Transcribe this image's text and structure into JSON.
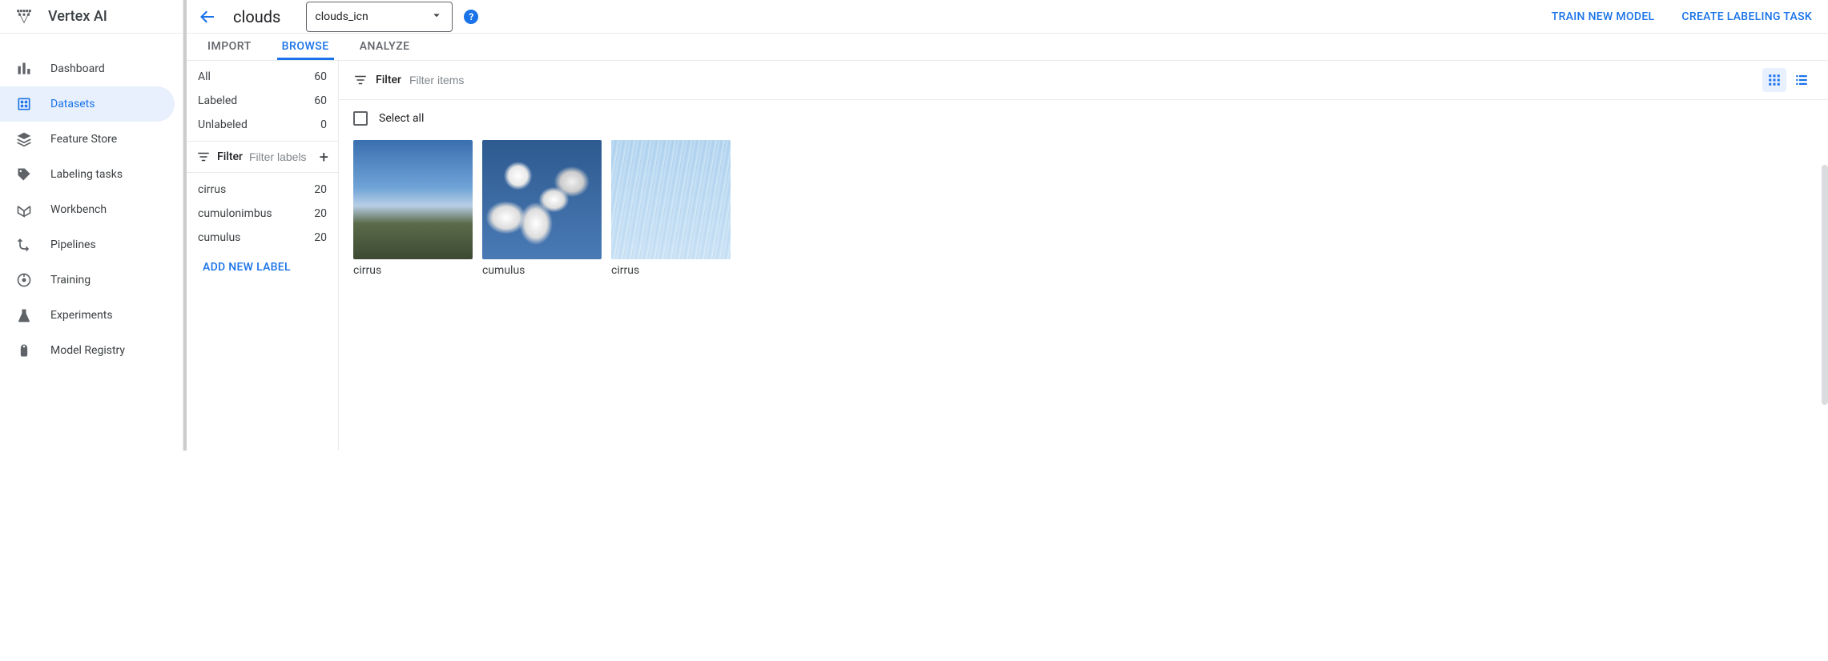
{
  "brand": {
    "title": "Vertex AI"
  },
  "nav": [
    {
      "label": "Dashboard",
      "icon": "dashboard-icon",
      "active": false
    },
    {
      "label": "Datasets",
      "icon": "datasets-icon",
      "active": true
    },
    {
      "label": "Feature Store",
      "icon": "feature-store-icon",
      "active": false
    },
    {
      "label": "Labeling tasks",
      "icon": "tag-icon",
      "active": false
    },
    {
      "label": "Workbench",
      "icon": "workbench-icon",
      "active": false
    },
    {
      "label": "Pipelines",
      "icon": "pipelines-icon",
      "active": false
    },
    {
      "label": "Training",
      "icon": "training-icon",
      "active": false
    },
    {
      "label": "Experiments",
      "icon": "experiments-icon",
      "active": false
    },
    {
      "label": "Model Registry",
      "icon": "model-registry-icon",
      "active": false
    }
  ],
  "header": {
    "dataset_name": "clouds",
    "selected_model": "clouds_icn",
    "actions": {
      "train": "TRAIN NEW MODEL",
      "label_task": "CREATE LABELING TASK"
    }
  },
  "tabs": [
    {
      "label": "IMPORT",
      "active": false
    },
    {
      "label": "BROWSE",
      "active": true
    },
    {
      "label": "ANALYZE",
      "active": false
    }
  ],
  "label_sidebar": {
    "stats": [
      {
        "label": "All",
        "count": "60"
      },
      {
        "label": "Labeled",
        "count": "60"
      },
      {
        "label": "Unlabeled",
        "count": "0"
      }
    ],
    "filter": {
      "label": "Filter",
      "placeholder": "Filter labels"
    },
    "labels": [
      {
        "label": "cirrus",
        "count": "20"
      },
      {
        "label": "cumulonimbus",
        "count": "20"
      },
      {
        "label": "cumulus",
        "count": "20"
      }
    ],
    "add_button": "ADD NEW LABEL"
  },
  "gallery": {
    "filter": {
      "label": "Filter",
      "placeholder": "Filter items"
    },
    "select_all": "Select all",
    "items": [
      {
        "label": "cirrus",
        "style": "sky1"
      },
      {
        "label": "cumulus",
        "style": "sky2"
      },
      {
        "label": "cirrus",
        "style": "sky3"
      }
    ]
  }
}
